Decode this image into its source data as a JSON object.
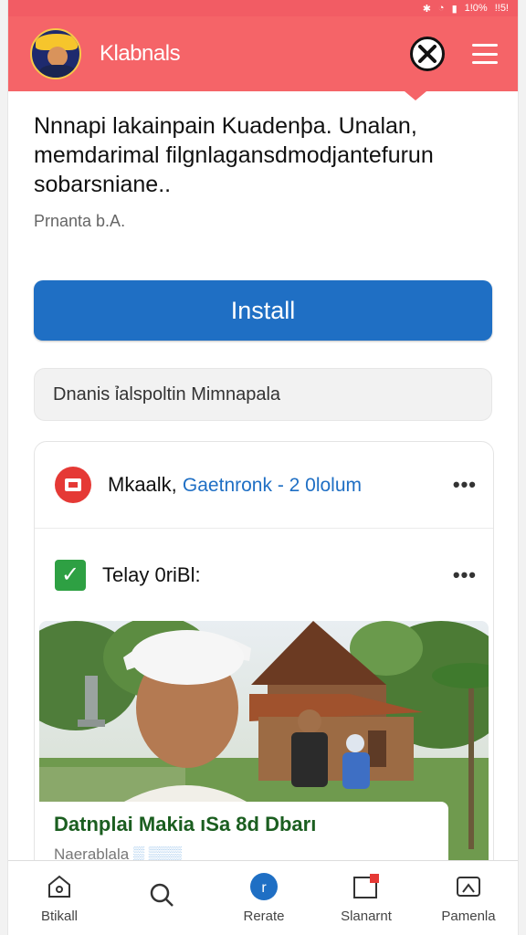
{
  "status_bar": {
    "battery": "1!0%",
    "extra": "!!5!"
  },
  "header": {
    "app_title": "Klabnals"
  },
  "article": {
    "headline": "Nnnapi lakainpain Kuadenþa. Unalan, memdarimal filgnlagansdmodjantefurun sobarsniane..",
    "author": "Prnanta b.A."
  },
  "install": {
    "label": "Install"
  },
  "search": {
    "text": "Dnanis ỉalspoltin Mimnapala"
  },
  "feed": {
    "row1": {
      "name": "Mkaalk,",
      "meta": "Gaetnronk - 2 0lolum"
    },
    "row2": {
      "name": "Telay 0riBl:"
    }
  },
  "image_card": {
    "title": "Datnplai Makia ıSa 8d Dbarı",
    "subtitle": "Naerablala",
    "subtitle_tag": "▒ ▒▒▒"
  },
  "bottom_nav": [
    {
      "label": "Btikall",
      "icon": "home-icon"
    },
    {
      "label": "",
      "icon": "search-icon"
    },
    {
      "label": "Rerate",
      "icon": "info-icon"
    },
    {
      "label": "Slanarnt",
      "icon": "notification-icon"
    },
    {
      "label": "Pamenla",
      "icon": "profile-icon"
    }
  ],
  "colors": {
    "header": "#f56468",
    "install_button": "#1f6fc4",
    "meta_text": "#1f6fc4",
    "caption_title": "#1b5e20",
    "check": "#2ea043",
    "alert": "#e53935"
  }
}
